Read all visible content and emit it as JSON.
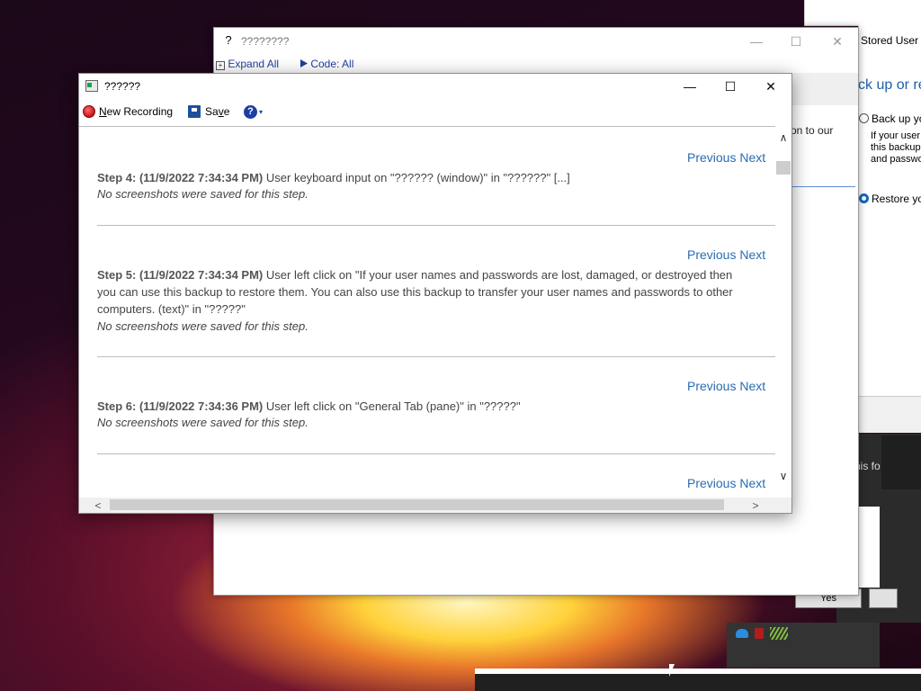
{
  "desktop": {
    "right_window": {
      "title": "Stored User N",
      "heading": "ck up or re",
      "option_backup": "Back up you",
      "option_backup_desc": [
        "If your user n",
        "this backup",
        "and passwo"
      ],
      "option_restore": "Restore you"
    },
    "dark_dialog": {
      "text": "his fo",
      "yes_label": "Yes"
    }
  },
  "background_window": {
    "title": "????????",
    "expand_all": "Expand All",
    "code_filter": "Code: All",
    "snippet": "on to our",
    "icon": "help-document-icon"
  },
  "psr": {
    "title": "??????",
    "toolbar": {
      "new_recording_mnemonic": "N",
      "new_recording_rest": "ew Recording",
      "save_pre": "Sa",
      "save_mnemonic": "v",
      "save_post": "e",
      "help_glyph": "?",
      "help_caret": "▾"
    },
    "prev_next": "Previous Next",
    "steps": [
      {
        "heading": "Step 4: (11/9/2022 7:34:34 PM)",
        "lines": [
          "User keyboard input on \"?????? (window)\" in \"??????\" [...]"
        ],
        "note": "No screenshots were saved for this step."
      },
      {
        "heading": "Step 5: (11/9/2022 7:34:34 PM)",
        "lines": [
          "User left click on \"If your user names and passwords are lost, damaged, or destroyed then",
          "you can use this backup to restore them. You can also use this backup to transfer your user names and passwords to other",
          "computers. (text)\" in \"?????\""
        ],
        "note": "No screenshots were saved for this step."
      },
      {
        "heading": "Step 6: (11/9/2022 7:34:36 PM)",
        "lines": [
          "User left click on \"General Tab (pane)\" in \"?????\""
        ],
        "note": "No screenshots were saved for this step."
      }
    ]
  },
  "glyphs": {
    "minimize": "—",
    "maximize": "☐",
    "close": "✕",
    "up": "∧",
    "down": "∨",
    "left": "<",
    "right": ">"
  }
}
